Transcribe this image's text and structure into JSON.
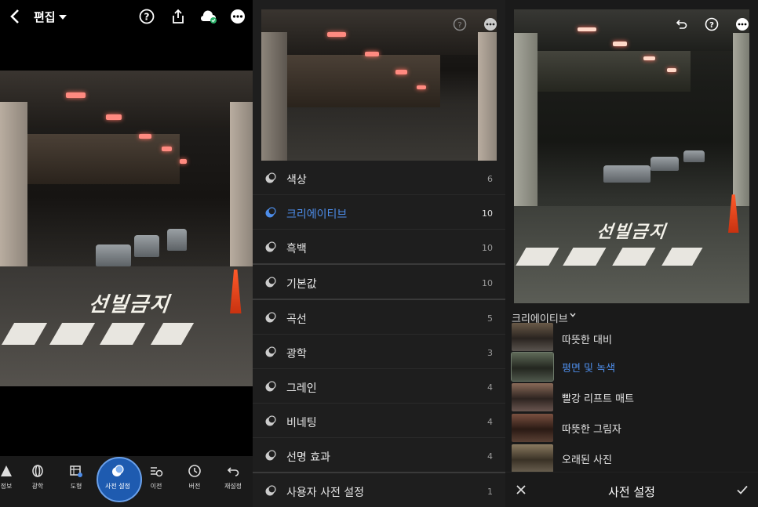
{
  "panel1": {
    "title": "편집",
    "toolbar": [
      {
        "label": "정보",
        "icon": "info-icon"
      },
      {
        "label": "광학",
        "icon": "optics-icon"
      },
      {
        "label": "도형",
        "icon": "geometry-icon"
      },
      {
        "label": "사전 설정",
        "icon": "presets-icon"
      },
      {
        "label": "이전",
        "icon": "previous-icon"
      },
      {
        "label": "버전",
        "icon": "versions-icon"
      },
      {
        "label": "재설정",
        "icon": "reset-icon"
      }
    ],
    "photo_text": "선빌금지"
  },
  "panel2": {
    "presets": [
      {
        "label": "색상",
        "count": "6"
      },
      {
        "label": "크리에이티브",
        "count": "10"
      },
      {
        "label": "흑백",
        "count": "10"
      },
      {
        "label": "기본값",
        "count": "10"
      },
      {
        "label": "곡선",
        "count": "5"
      },
      {
        "label": "광학",
        "count": "3"
      },
      {
        "label": "그레인",
        "count": "4"
      },
      {
        "label": "비네팅",
        "count": "4"
      },
      {
        "label": "선명 효과",
        "count": "4"
      },
      {
        "label": "사용자 사전 설정",
        "count": "1"
      }
    ]
  },
  "panel3": {
    "category": "크리에이티브",
    "items": [
      {
        "label": "따뜻한 대비"
      },
      {
        "label": "평면 및 녹색"
      },
      {
        "label": "빨강 리프트 매트"
      },
      {
        "label": "따뜻한 그림자"
      },
      {
        "label": "오래된 사진"
      }
    ],
    "footer_title": "사전 설정",
    "photo_text": "선빌금지"
  },
  "colors": {
    "accent": "#4d8ce8",
    "active_button": "#1e5bb0"
  }
}
